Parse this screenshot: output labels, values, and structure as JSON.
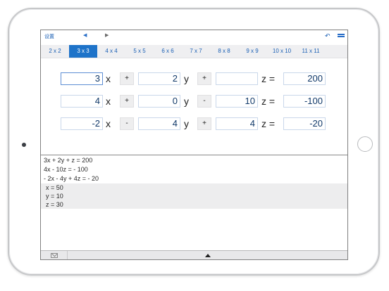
{
  "topbar": {
    "settings_label": "设置",
    "back_glyph": "◀",
    "forward_glyph": "▶",
    "undo_glyph": "↶"
  },
  "size_tabs": [
    {
      "label": "2 x 2",
      "active": false
    },
    {
      "label": "3 x 3",
      "active": true
    },
    {
      "label": "4 x 4",
      "active": false
    },
    {
      "label": "5 x 5",
      "active": false
    },
    {
      "label": "6 x 6",
      "active": false
    },
    {
      "label": "7 x 7",
      "active": false
    },
    {
      "label": "8 x 8",
      "active": false
    },
    {
      "label": "9 x 9",
      "active": false
    },
    {
      "label": "10 x 10",
      "active": false
    },
    {
      "label": "11 x 11",
      "active": false
    }
  ],
  "equations": [
    {
      "c1": "3",
      "v1": "x",
      "op1": "+",
      "c2": "2",
      "v2": "y",
      "op2": "+",
      "c3": "",
      "v3": "z =",
      "rhs": "200"
    },
    {
      "c1": "4",
      "v1": "x",
      "op1": "+",
      "c2": "0",
      "v2": "y",
      "op2": "-",
      "c3": "10",
      "v3": "z =",
      "rhs": "-100"
    },
    {
      "c1": "-2",
      "v1": "x",
      "op1": "-",
      "c2": "4",
      "v2": "y",
      "op2": "+",
      "c3": "4",
      "v3": "z =",
      "rhs": "-20"
    }
  ],
  "result": {
    "equations_text": [
      "3x + 2y + z = 200",
      "4x - 10z = - 100",
      "- 2x - 4y + 4z = - 20"
    ],
    "solutions": [
      "x = 50",
      "y = 10",
      "z = 30"
    ]
  },
  "icons": {
    "mail": "mail-icon",
    "expand": "expand-up-icon",
    "undo": "undo-icon",
    "menu": "menu-icon"
  },
  "colors": {
    "accent": "#1e73c9",
    "tab_bar": "#efeff1",
    "solution_bg": "#ededee"
  }
}
